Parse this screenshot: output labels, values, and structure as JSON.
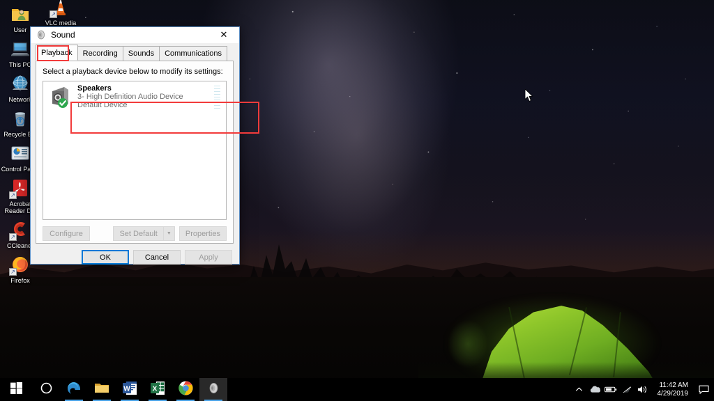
{
  "desktop": {
    "icons": [
      {
        "label": "User",
        "icon": "user-folder-icon"
      },
      {
        "label": "This PC",
        "icon": "computer-icon"
      },
      {
        "label": "Network",
        "icon": "network-globe-icon"
      },
      {
        "label": "Recycle Bin",
        "icon": "recycle-bin-icon"
      },
      {
        "label": "Control Panel",
        "icon": "control-panel-icon"
      },
      {
        "label": "Acrobat Reader DC",
        "icon": "acrobat-reader-icon"
      },
      {
        "label": "CCleaner",
        "icon": "ccleaner-icon"
      },
      {
        "label": "Firefox",
        "icon": "firefox-icon"
      }
    ],
    "top_partial_icon": {
      "label": "VLC media",
      "icon": "vlc-cone-icon"
    },
    "wallpaper_description": "Night camping scene with glowing green tent under the Milky Way"
  },
  "dialog": {
    "title": "Sound",
    "title_icon": "speaker-icon",
    "close_label": "✕",
    "tabs": [
      {
        "label": "Playback",
        "active": true,
        "highlighted": true
      },
      {
        "label": "Recording",
        "active": false,
        "highlighted": false
      },
      {
        "label": "Sounds",
        "active": false,
        "highlighted": false
      },
      {
        "label": "Communications",
        "active": false,
        "highlighted": false
      }
    ],
    "instruction": "Select a playback device below to modify its settings:",
    "device": {
      "name": "Speakers",
      "description": "3- High Definition Audio Device",
      "status": "Default Device",
      "icon": "speaker-device-icon",
      "badge": "default-check-badge",
      "meter_segments": 9,
      "highlighted": true
    },
    "panel_buttons": {
      "configure": "Configure",
      "set_default": "Set Default",
      "set_default_arrow": "▼",
      "properties": "Properties"
    },
    "footer_buttons": {
      "ok": "OK",
      "cancel": "Cancel",
      "apply": "Apply"
    }
  },
  "taskbar": {
    "items": [
      {
        "name": "start-button",
        "icon": "windows-logo-icon"
      },
      {
        "name": "cortana-search",
        "icon": "cortana-circle-icon"
      },
      {
        "name": "microsoft-edge",
        "icon": "edge-icon"
      },
      {
        "name": "file-explorer",
        "icon": "folder-icon"
      },
      {
        "name": "microsoft-word",
        "icon": "word-icon"
      },
      {
        "name": "microsoft-excel",
        "icon": "excel-icon"
      },
      {
        "name": "google-chrome",
        "icon": "chrome-icon"
      },
      {
        "name": "sound-control-panel",
        "icon": "speaker-icon"
      }
    ],
    "tray": {
      "show_hidden": "∧",
      "icons": [
        {
          "name": "onedrive-icon"
        },
        {
          "name": "battery-icon"
        },
        {
          "name": "wifi-icon"
        },
        {
          "name": "volume-icon"
        }
      ],
      "time": "11:42 AM",
      "date": "4/29/2019",
      "action_center": "notification-icon"
    }
  },
  "colors": {
    "highlight_red": "#f23b3b",
    "accent_blue": "#0078d7",
    "taskbar_black": "#000000",
    "dialog_gray": "#f0f0f0",
    "tent_green": "#8ec62a"
  }
}
